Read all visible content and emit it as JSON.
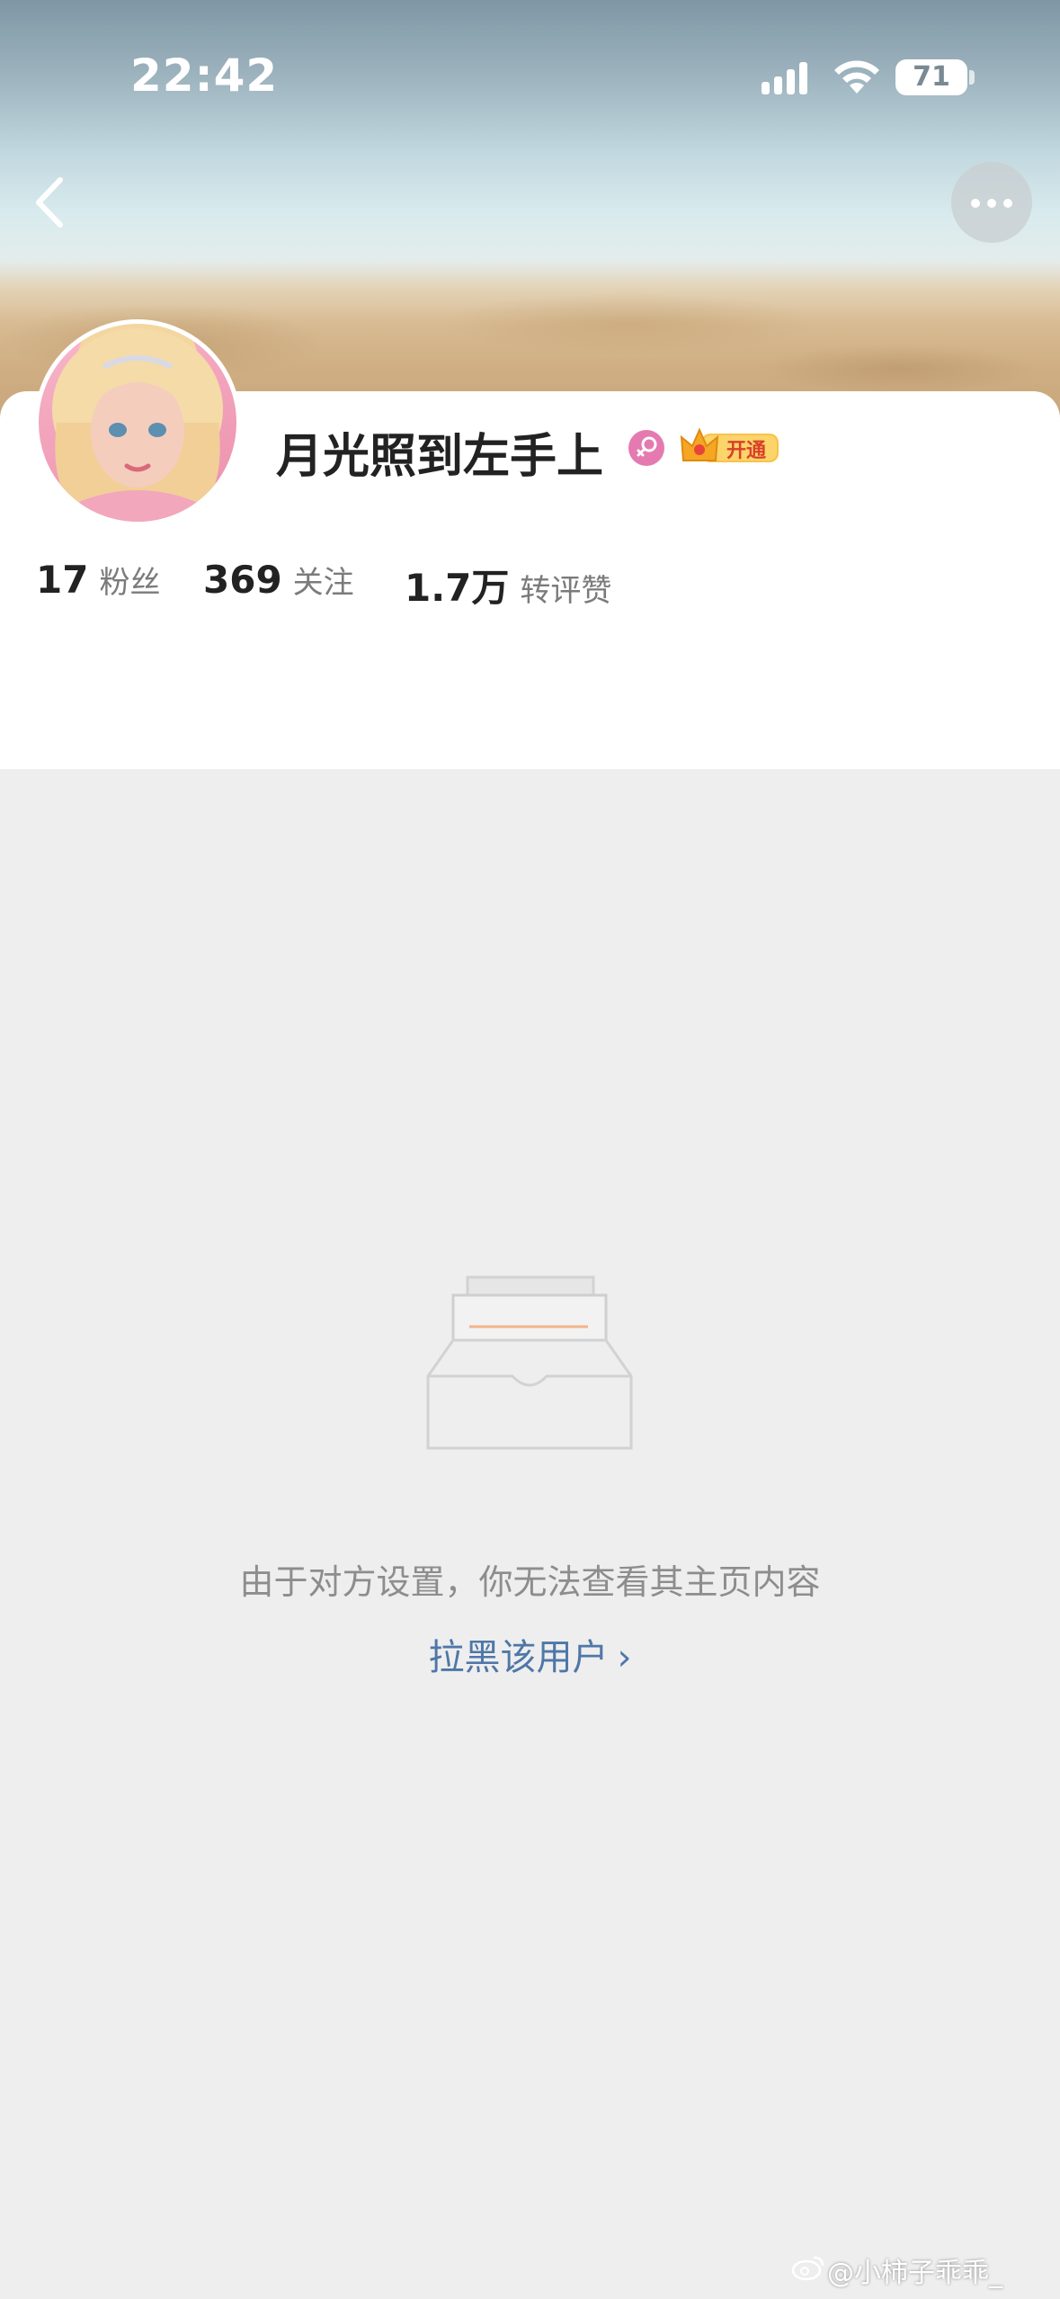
{
  "status_bar": {
    "time": "22:42",
    "battery": "71"
  },
  "profile": {
    "username": "月光照到左手上",
    "vip_label": "开通",
    "stats": [
      {
        "num": "17",
        "label": "粉丝"
      },
      {
        "num": "369",
        "label": "关注"
      },
      {
        "num": "1.7万",
        "label": "转评赞"
      }
    ]
  },
  "empty_state": {
    "message": "由于对方设置，你无法查看其主页内容",
    "action": "拉黑该用户",
    "action_chevron": "›"
  },
  "watermark": "@小柿子乖乖_",
  "colors": {
    "link": "#4f77a8",
    "vip": "#f5a623",
    "gender_female": "#e57ab0"
  },
  "icons": {
    "back": "chevron-left-icon",
    "more": "more-dots-icon",
    "gender": "female-icon",
    "vip": "crown-icon",
    "empty": "empty-box-icon",
    "watermark": "weibo-icon"
  }
}
